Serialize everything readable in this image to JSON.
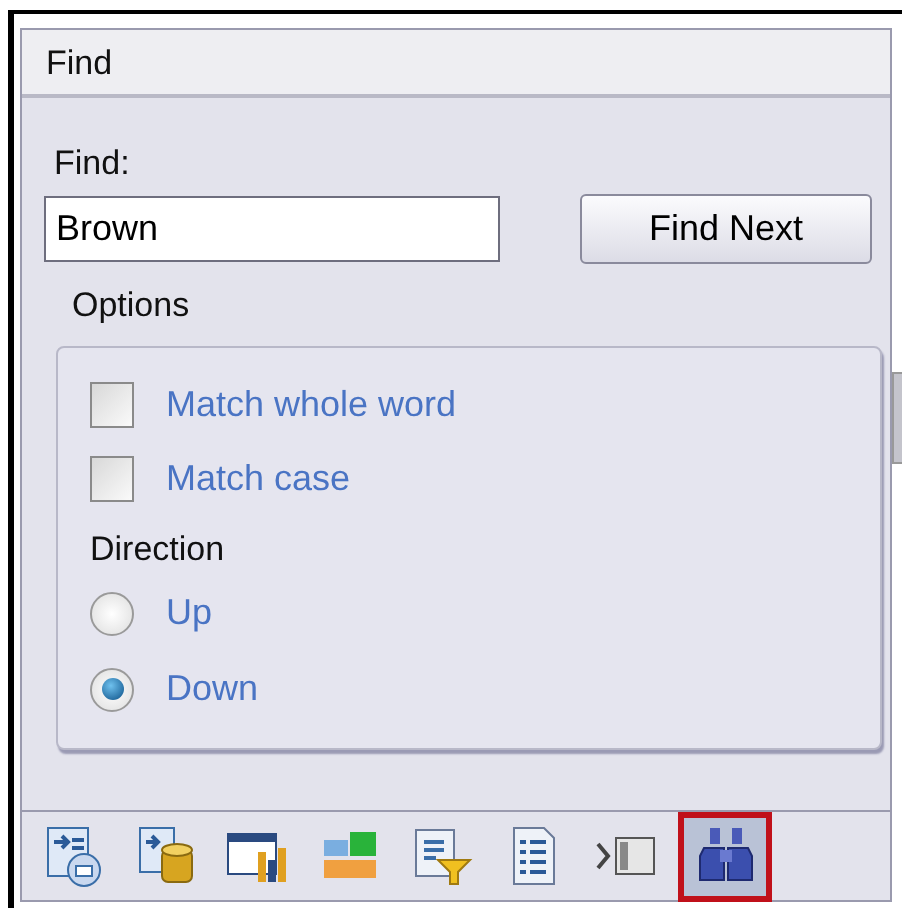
{
  "panel": {
    "title": "Find"
  },
  "find": {
    "label": "Find:",
    "value": "Brown",
    "button": "Find Next"
  },
  "options": {
    "title": "Options",
    "checkboxes": [
      {
        "label": "Match whole word",
        "checked": false
      },
      {
        "label": "Match case",
        "checked": false
      }
    ],
    "direction": {
      "label": "Direction",
      "radios": [
        {
          "label": "Up",
          "selected": false
        },
        {
          "label": "Down",
          "selected": true
        }
      ]
    }
  },
  "toolbar": [
    {
      "selected": false
    },
    {
      "selected": false
    },
    {
      "selected": false
    },
    {
      "selected": false
    },
    {
      "selected": false
    },
    {
      "selected": false
    },
    {
      "selected": false
    },
    {
      "selected": true
    }
  ]
}
